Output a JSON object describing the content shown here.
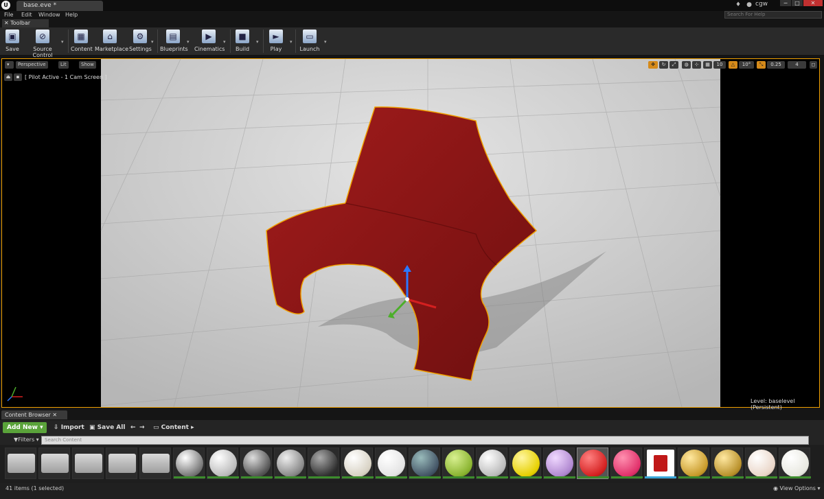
{
  "window": {
    "document_tab": "base.eve *",
    "username": "cgw",
    "help_search_placeholder": "Search For Help",
    "minimize": "−",
    "restore": "□",
    "close": "✕"
  },
  "menu": [
    "File",
    "Edit",
    "Window",
    "Help"
  ],
  "toolbar_tab": "Toolbar",
  "toolbar": [
    {
      "label": "Save",
      "icon": "save-icon"
    },
    {
      "label": "Source Control",
      "icon": "source-control-icon"
    },
    {
      "label": "Content",
      "icon": "content-icon"
    },
    {
      "label": "Marketplace",
      "icon": "marketplace-icon"
    },
    {
      "label": "Settings",
      "icon": "settings-icon"
    },
    {
      "label": "Blueprints",
      "icon": "blueprints-icon"
    },
    {
      "label": "Cinematics",
      "icon": "cinematics-icon"
    },
    {
      "label": "Build",
      "icon": "build-icon"
    },
    {
      "label": "Play",
      "icon": "play-icon"
    },
    {
      "label": "Launch",
      "icon": "launch-icon"
    }
  ],
  "viewport": {
    "perspective": "Perspective",
    "lit": "Lit",
    "show": "Show",
    "pilot": "[ Pilot Active - 1 Cam Screen ]",
    "grid_snap": "10",
    "rotation_snap": "10°",
    "scale_snap": "0.25",
    "camera_speed": "4",
    "level_label": "Level:  baselevel (Persistent)"
  },
  "content_browser": {
    "tab": "Content Browser",
    "add_new": "Add New",
    "import": "Import",
    "save_all": "Save All",
    "path": "Content",
    "filters": "Filters",
    "search_placeholder": "Search Content",
    "status": "41 items (1 selected)",
    "view_options": "View Options"
  },
  "colors": {
    "accent": "#f0a000",
    "chair_red": "#8b1414",
    "add_new_green": "#5aa33a",
    "material_bar": "#3c8c2c"
  }
}
